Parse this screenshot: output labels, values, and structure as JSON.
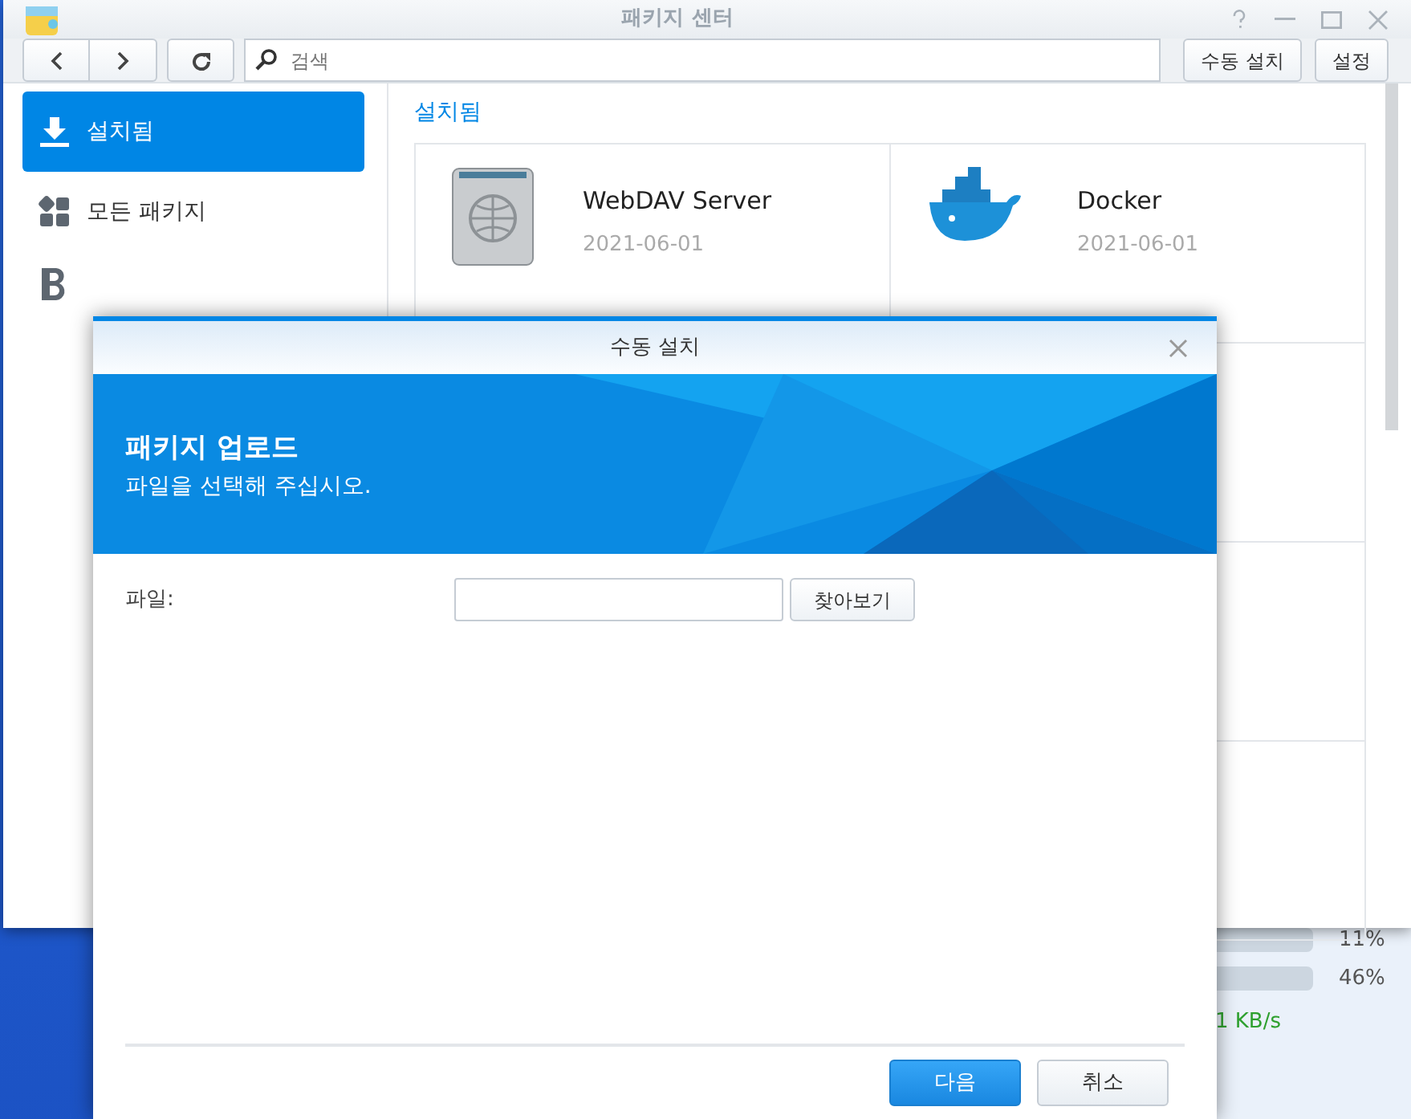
{
  "window": {
    "title": "패키지 센터"
  },
  "toolbar": {
    "search": {
      "placeholder": "검색"
    },
    "buttons": [
      "수동 설치",
      "설정"
    ]
  },
  "sidebar": {
    "items": [
      {
        "label": "설치됨",
        "selected": true
      },
      {
        "label": "모든 패키지",
        "selected": false
      },
      {
        "selected": false
      }
    ]
  },
  "content": {
    "title": "설치됨",
    "packages": [
      {
        "name": "WebDAV Server",
        "date": "2021-06-01"
      },
      {
        "name": "Docker",
        "date": "2021-06-01"
      }
    ]
  },
  "widget": {
    "readings": [
      "11%",
      "46%"
    ],
    "speed": "1 KB/s"
  },
  "dialog": {
    "title": "수동 설치",
    "banner_title": "패키지 업로드",
    "banner_subtitle": "파일을 선택해 주십시오.",
    "file_label": "파일:",
    "browse_button": "찾아보기",
    "buttons": [
      {
        "label": "다음",
        "primary": true
      },
      {
        "label": "취소",
        "primary": false
      }
    ]
  }
}
